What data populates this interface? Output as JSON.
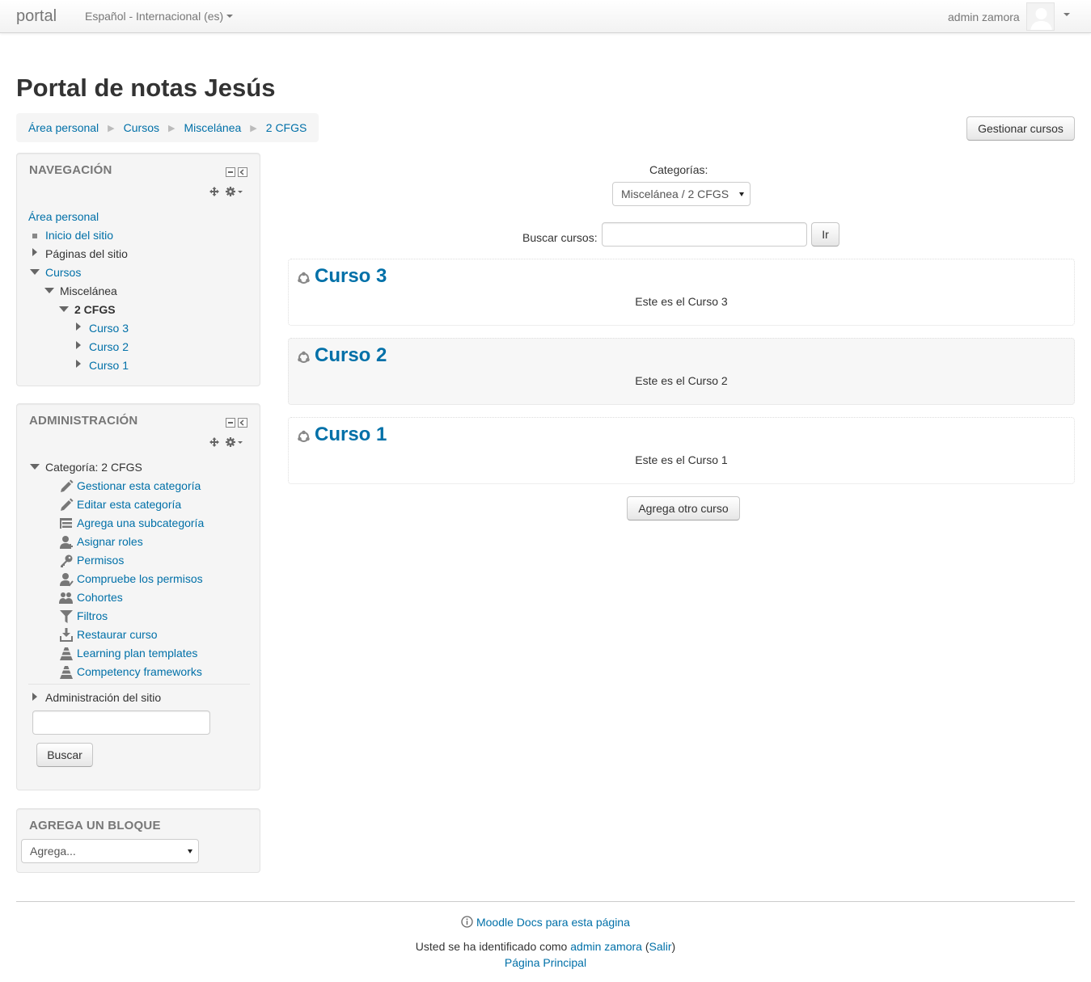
{
  "navbar": {
    "brand": "portal",
    "language": "Español - Internacional (es)",
    "user_name": "admin zamora"
  },
  "header": {
    "title": "Portal de notas Jesús",
    "breadcrumb": [
      "Área personal",
      "Cursos",
      "Miscelánea",
      "2 CFGS"
    ],
    "manage_button": "Gestionar cursos"
  },
  "navigation_block": {
    "title": "NAVEGACIÓN",
    "items": [
      "Área personal",
      "Inicio del sitio",
      "Páginas del sitio",
      "Cursos",
      "Miscelánea",
      "2 CFGS",
      "Curso 3",
      "Curso 2",
      "Curso 1"
    ]
  },
  "admin_block": {
    "title": "ADMINISTRACIÓN",
    "category": "Categoría: 2 CFGS",
    "items": [
      {
        "label": "Gestionar esta categoría",
        "icon": "pencil-icon"
      },
      {
        "label": "Editar esta categoría",
        "icon": "pencil-icon"
      },
      {
        "label": "Agrega una subcategoría",
        "icon": "subcategory-icon"
      },
      {
        "label": "Asignar roles",
        "icon": "assign-roles-icon"
      },
      {
        "label": "Permisos",
        "icon": "key-icon"
      },
      {
        "label": "Compruebe los permisos",
        "icon": "check-permissions-icon"
      },
      {
        "label": "Cohortes",
        "icon": "cohorts-icon"
      },
      {
        "label": "Filtros",
        "icon": "filter-icon"
      },
      {
        "label": "Restaurar curso",
        "icon": "restore-icon"
      },
      {
        "label": "Learning plan templates",
        "icon": "pyramid-icon"
      },
      {
        "label": "Competency frameworks",
        "icon": "pyramid-icon"
      }
    ],
    "site_admin": "Administración del sitio",
    "search_button": "Buscar"
  },
  "add_block": {
    "title": "AGREGA UN BLOQUE",
    "select_value": "Agrega..."
  },
  "main": {
    "categories_label": "Categorías:",
    "category_value": "Miscelánea / 2 CFGS",
    "search_label": "Buscar cursos:",
    "go_button": "Ir",
    "courses": [
      {
        "name": "Curso 3",
        "summary": "Este es el Curso 3"
      },
      {
        "name": "Curso 2",
        "summary": "Este es el Curso 2"
      },
      {
        "name": "Curso 1",
        "summary": "Este es el Curso 1"
      }
    ],
    "add_course_button": "Agrega otro curso"
  },
  "footer": {
    "docs_link": "Moodle Docs para esta página",
    "logged_in_prefix": "Usted se ha identificado como",
    "user_link": "admin zamora",
    "logout_link": "Salir",
    "home_link": "Página Principal"
  },
  "colors": {
    "link": "#0070a8",
    "block_background": "#f5f5f5",
    "text": "#333333"
  }
}
